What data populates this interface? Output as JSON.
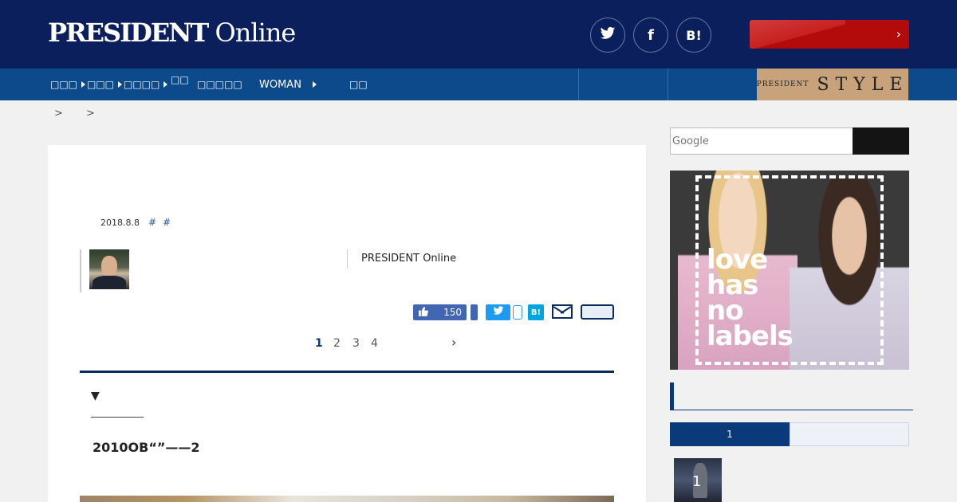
{
  "header": {
    "logo_bold": "PRESIDENT",
    "logo_light": " Online",
    "social": {
      "twitter": "🐦",
      "facebook": "f",
      "hatena": "B!"
    },
    "promo_chevron": "›"
  },
  "nav": {
    "items": [
      "□□□",
      "□□□",
      "□□□□",
      "□□",
      "□□□□□",
      "WOMAN",
      "□□"
    ],
    "style_prefix": "PRESIDENT",
    "style_label": "STYLE"
  },
  "breadcrumb": {
    "sep1": ">",
    "sep2": ">"
  },
  "article": {
    "date": "2018.8.8",
    "tags": [
      "#",
      "#"
    ],
    "publisher": "PRESIDENT Online",
    "like_count": "150",
    "hatena_label": "B!",
    "pages": [
      "1",
      "2",
      "3",
      "4"
    ],
    "next_chevron": "›",
    "toc_marker": "▼",
    "headline": "2010OB“”——2"
  },
  "sidebar": {
    "search_placeholder": "Google",
    "ad_text": "love\nhas\nno\nlabels",
    "rank_tab": "1",
    "rank_number": "1"
  },
  "colors": {
    "header_bg": "#0b1f5c",
    "nav_bg": "#0d4a8c",
    "promo": "#b30b0b",
    "style_badge": "#c8a27a",
    "facebook": "#4267b2",
    "twitter": "#1d9bf0",
    "hatena": "#00a4de",
    "accent": "#0b3a7a"
  },
  "icons": [
    "twitter-icon",
    "facebook-icon",
    "hatena-icon",
    "like-icon",
    "mail-icon",
    "chevron-right-icon"
  ]
}
